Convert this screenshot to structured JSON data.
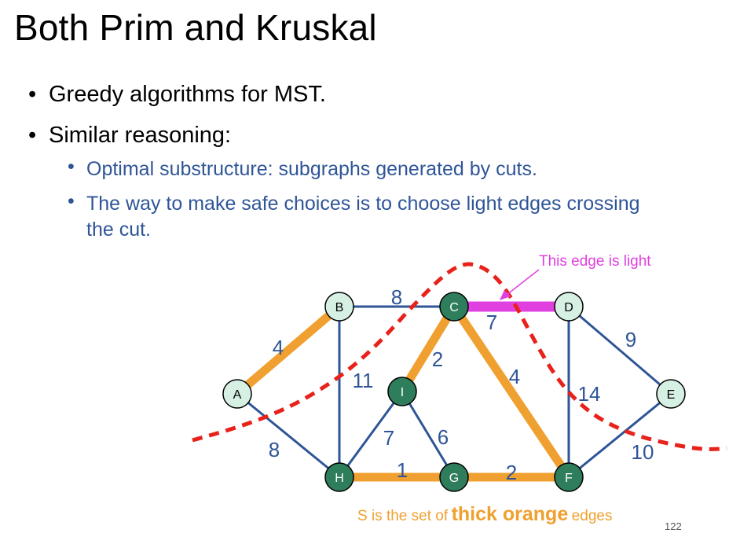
{
  "title": "Both Prim and Kruskal",
  "bullets": [
    {
      "text": "Greedy algorithms for MST."
    },
    {
      "text": "Similar reasoning:"
    }
  ],
  "subbullets": [
    {
      "text": "Optimal substructure: subgraphs generated by cuts."
    },
    {
      "text": "The way to make safe choices is to choose light edges crossing the cut."
    }
  ],
  "bullet_glyph": "•",
  "annotation": "This edge is light",
  "caption": {
    "pre": "S is the set of",
    "bold": "thick orange",
    "post": "edges"
  },
  "page_number": "122",
  "colors": {
    "blue_edge": "#2f5597",
    "orange_edge": "#f0a030",
    "light_edge": "#e040e0",
    "cut_line": "#e8221a",
    "node_light": "#d6f0e4",
    "node_dark": "#2e7d5b",
    "weight_text": "#2f5597"
  },
  "graph": {
    "nodes": [
      {
        "id": "A",
        "label": "A",
        "style": "light"
      },
      {
        "id": "B",
        "label": "B",
        "style": "light"
      },
      {
        "id": "C",
        "label": "C",
        "style": "dark"
      },
      {
        "id": "D",
        "label": "D",
        "style": "light"
      },
      {
        "id": "E",
        "label": "E",
        "style": "light"
      },
      {
        "id": "F",
        "label": "F",
        "style": "dark"
      },
      {
        "id": "G",
        "label": "G",
        "style": "dark"
      },
      {
        "id": "H",
        "label": "H",
        "style": "dark"
      },
      {
        "id": "I",
        "label": "I",
        "style": "dark"
      }
    ],
    "edges": [
      {
        "from": "A",
        "to": "B",
        "weight": "4",
        "style": "orange"
      },
      {
        "from": "A",
        "to": "H",
        "weight": "8",
        "style": "blue"
      },
      {
        "from": "B",
        "to": "C",
        "weight": "8",
        "style": "blue"
      },
      {
        "from": "B",
        "to": "H",
        "weight": "11",
        "style": "blue"
      },
      {
        "from": "C",
        "to": "D",
        "weight": "7",
        "style": "light"
      },
      {
        "from": "C",
        "to": "I",
        "weight": "2",
        "style": "orange"
      },
      {
        "from": "C",
        "to": "F",
        "weight": "4",
        "style": "orange"
      },
      {
        "from": "D",
        "to": "E",
        "weight": "9",
        "style": "blue"
      },
      {
        "from": "D",
        "to": "F",
        "weight": "14",
        "style": "blue"
      },
      {
        "from": "E",
        "to": "F",
        "weight": "10",
        "style": "blue"
      },
      {
        "from": "H",
        "to": "I",
        "weight": "7",
        "style": "blue"
      },
      {
        "from": "I",
        "to": "G",
        "weight": "6",
        "style": "blue"
      },
      {
        "from": "H",
        "to": "G",
        "weight": "1",
        "style": "orange"
      },
      {
        "from": "G",
        "to": "F",
        "weight": "2",
        "style": "orange"
      }
    ]
  }
}
